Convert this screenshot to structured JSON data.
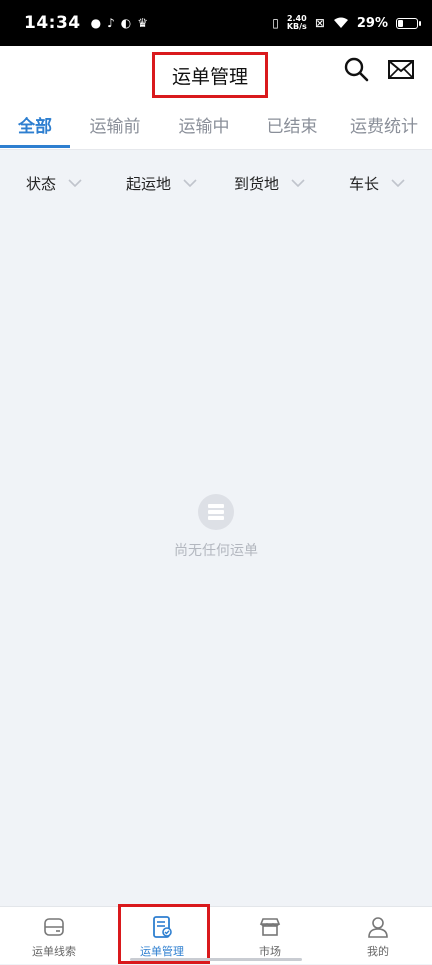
{
  "status_bar": {
    "time": "14:34",
    "net_speed_value": "2.40",
    "net_speed_unit": "KB/s",
    "battery": "29%",
    "battery_level": 0.29
  },
  "header": {
    "title": "运单管理"
  },
  "tabs": [
    {
      "label": "全部",
      "active": true
    },
    {
      "label": "运输前",
      "active": false
    },
    {
      "label": "运输中",
      "active": false
    },
    {
      "label": "已结束",
      "active": false
    },
    {
      "label": "运费统计",
      "active": false
    }
  ],
  "filters": [
    {
      "label": "状态"
    },
    {
      "label": "起运地"
    },
    {
      "label": "到货地"
    },
    {
      "label": "车长"
    }
  ],
  "empty_state": {
    "message": "尚无任何运单"
  },
  "bottom_nav": [
    {
      "label": "运单线索",
      "icon": "card-icon",
      "active": false
    },
    {
      "label": "运单管理",
      "icon": "document-icon",
      "active": true
    },
    {
      "label": "市场",
      "icon": "store-icon",
      "active": false
    },
    {
      "label": "我的",
      "icon": "user-icon",
      "active": false
    }
  ],
  "colors": {
    "accent": "#2e7fd0",
    "highlight_border": "#d9191c",
    "background": "#f0f3f7"
  }
}
